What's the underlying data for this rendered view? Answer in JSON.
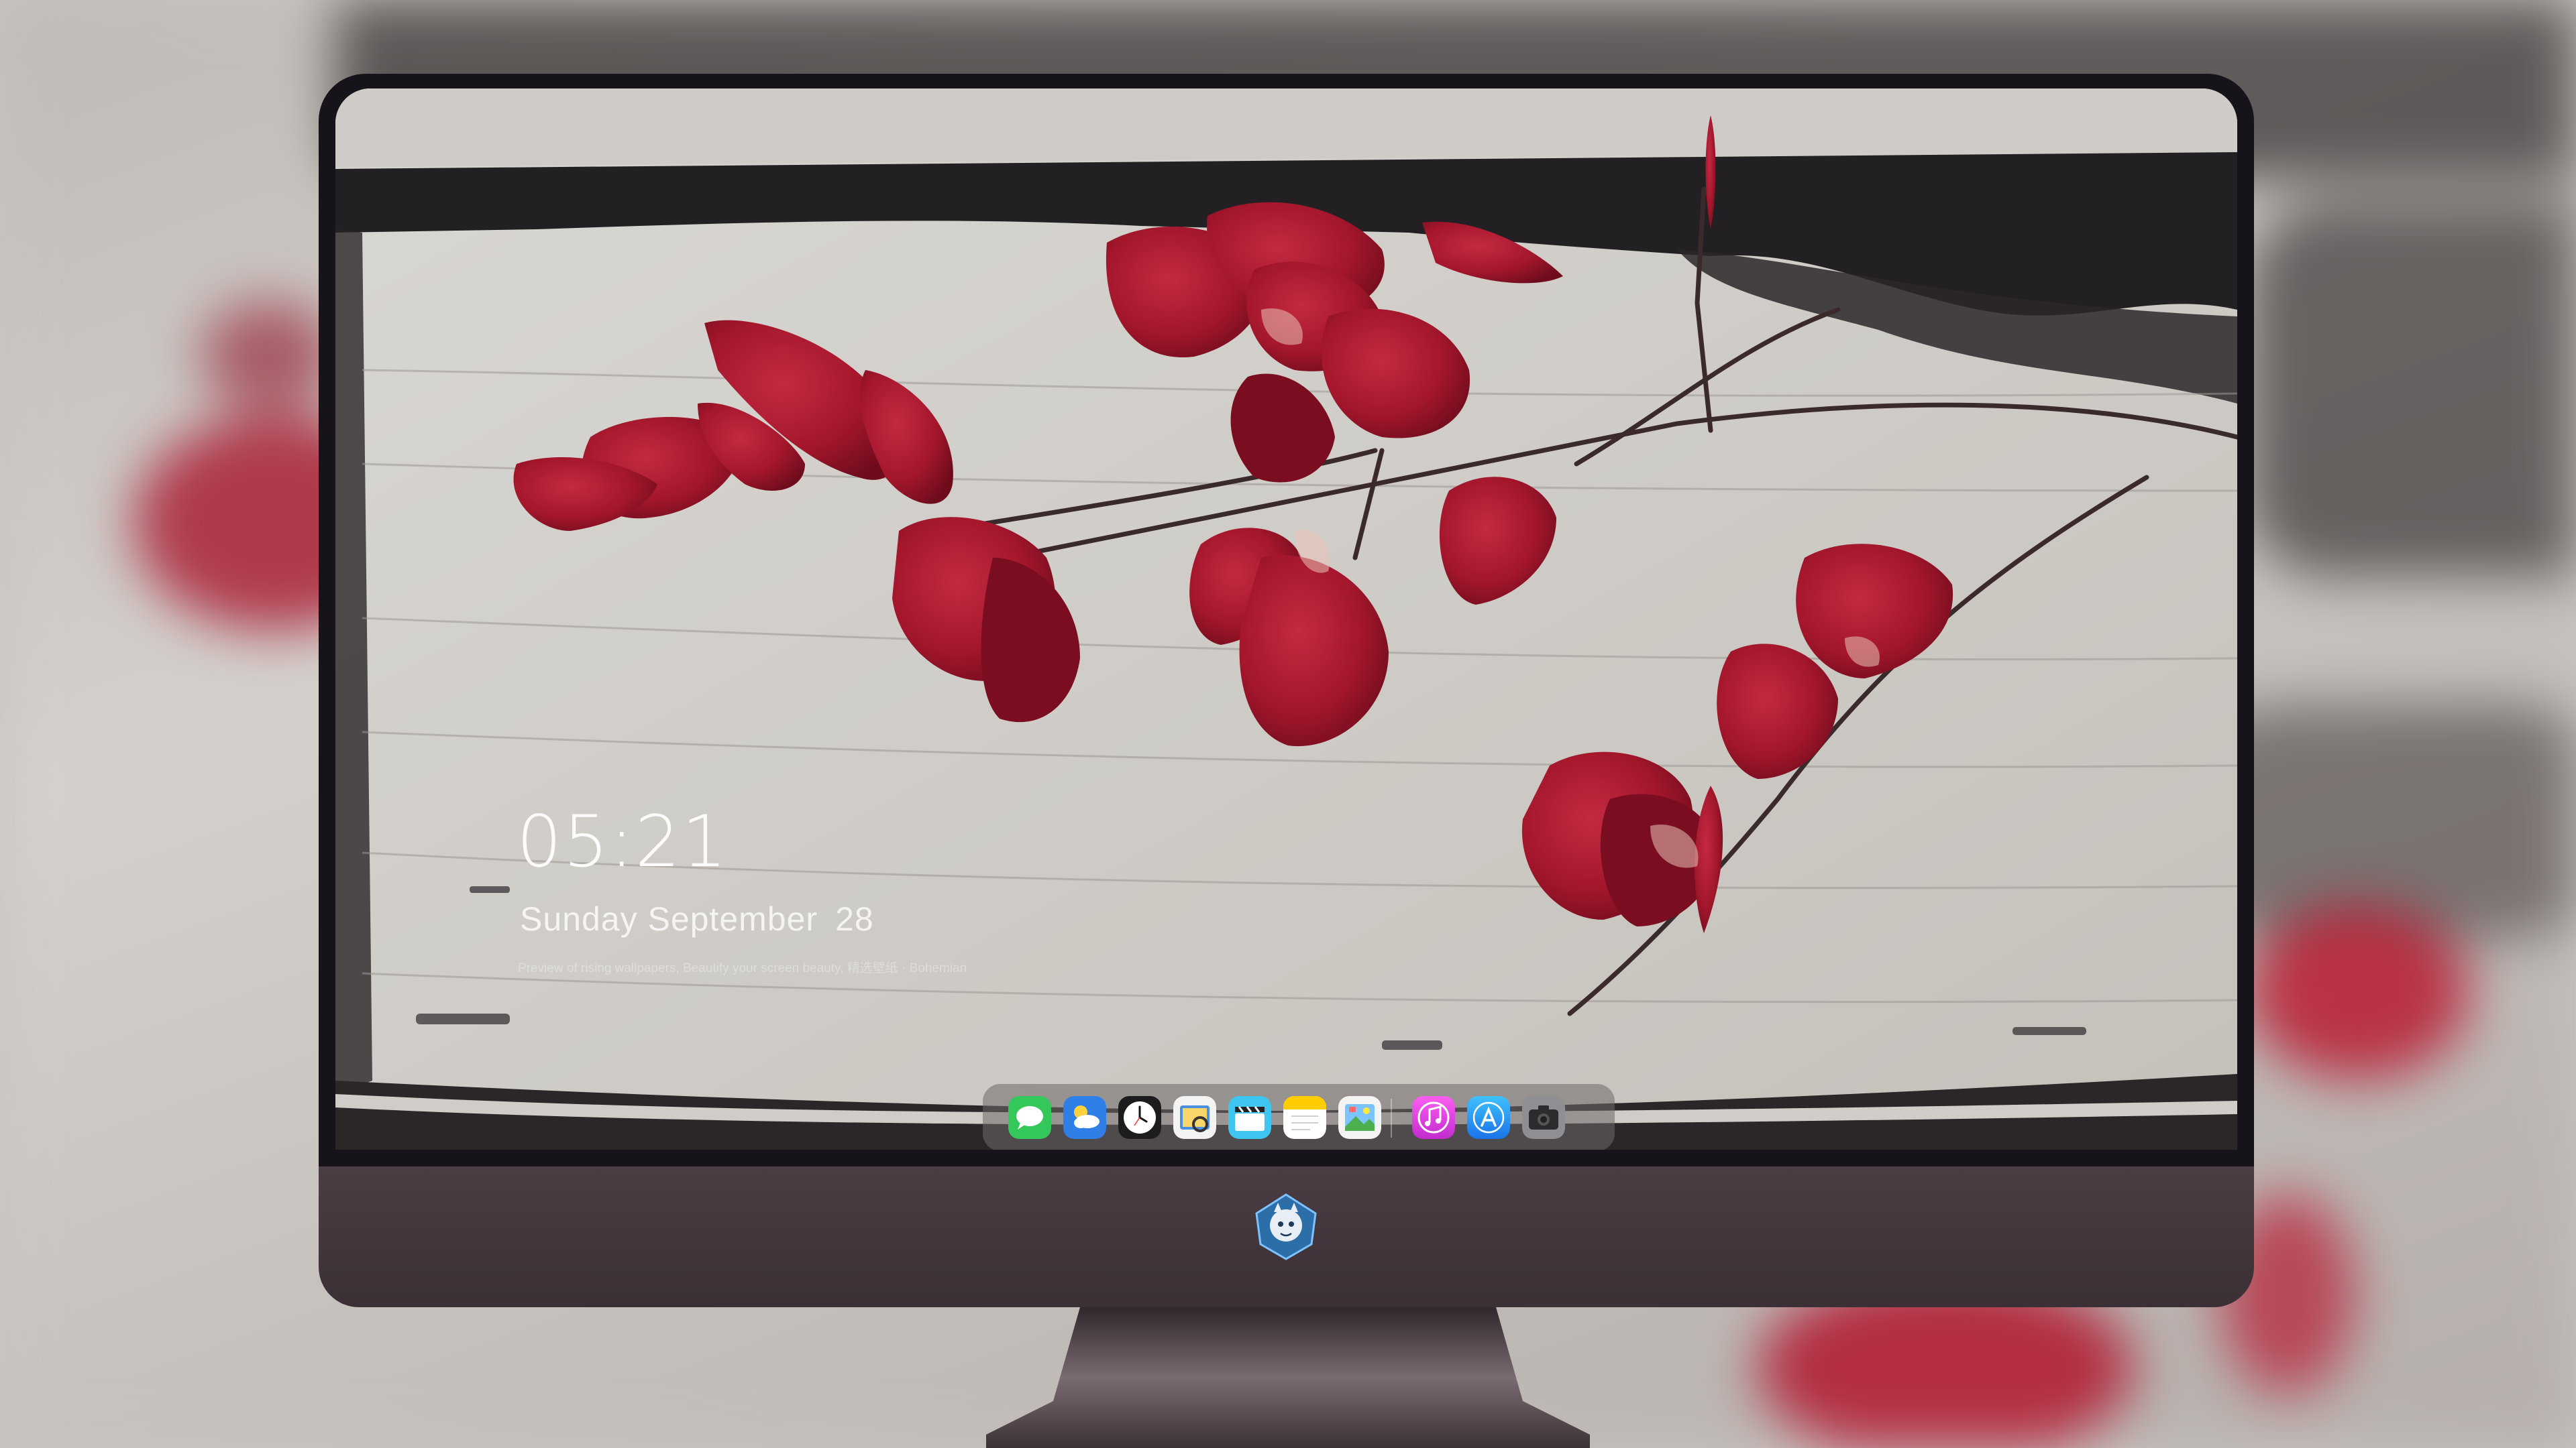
{
  "lockscreen": {
    "time": "05:21",
    "weekday_month": "Sunday September",
    "day": "28",
    "caption": "Preview of rising wallpapers, Beautify your screen beauty, 精选壁纸 · Bohemian"
  },
  "dock": {
    "apps": [
      {
        "name": "Messages",
        "icon": "messages-icon"
      },
      {
        "name": "Weather",
        "icon": "weather-icon"
      },
      {
        "name": "Clock",
        "icon": "clock-icon"
      },
      {
        "name": "Preview",
        "icon": "preview-icon"
      },
      {
        "name": "Clips",
        "icon": "clapperboard-icon"
      },
      {
        "name": "Notes",
        "icon": "notes-icon"
      },
      {
        "name": "Photo Gallery",
        "icon": "gallery-icon"
      },
      {
        "name": "Music",
        "icon": "music-icon"
      },
      {
        "name": "App Store",
        "icon": "app-store-icon"
      },
      {
        "name": "Camera",
        "icon": "camera-icon"
      }
    ]
  },
  "colors": {
    "petal_red": "#a3162c",
    "wood_light": "#d8d6d2",
    "monitor_chin": "#45393f",
    "dock_bg": "#6e6868"
  }
}
